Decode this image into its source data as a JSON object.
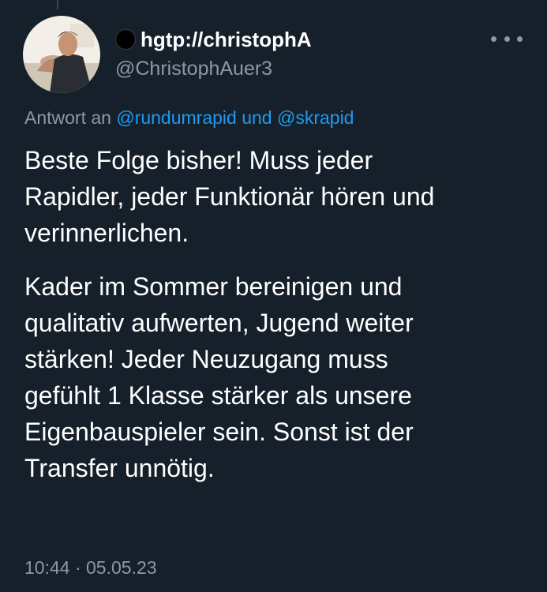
{
  "author": {
    "display_name": "hgtp://christophA",
    "handle": "@ChristophAuer3"
  },
  "reply": {
    "prefix": "Antwort an",
    "mention_1": "@rundumrapid",
    "conjunction": "und",
    "mention_2": "@skrapid"
  },
  "tweet": {
    "paragraph_1": "Beste Folge bisher! Muss jeder\nRapidler, jeder Funktionär hören und\nverinnerlichen.",
    "paragraph_2": "Kader im Sommer bereinigen und\nqualitativ aufwerten, Jugend weiter\nstärken! Jeder Neuzugang muss\ngefühlt 1 Klasse stärker als unsere\nEigenbauspieler sein. Sonst ist der\nTransfer unnötig."
  },
  "meta": {
    "time": "10:44",
    "separator": "·",
    "date": "05.05.23"
  },
  "icons": {
    "avatar": "profile-photo",
    "name_badge": "black-circle",
    "more": "more-horizontal-icon"
  },
  "colors": {
    "background": "#15202b",
    "text_primary": "#ffffff",
    "text_secondary": "#8b98a5",
    "accent_link": "#1d9bf0"
  }
}
